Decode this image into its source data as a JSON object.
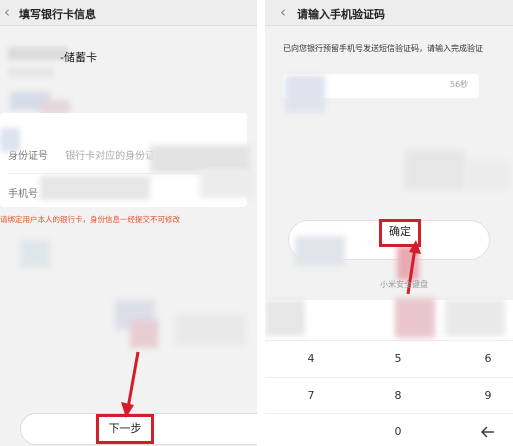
{
  "left_screen": {
    "back_icon": "chevron-left-icon",
    "title": "填写银行卡信息",
    "card_name": "-储蓄卡",
    "form": {
      "id_label": "身份证号",
      "id_placeholder": "银行卡对应的身份证号",
      "phone_label": "手机号"
    },
    "warning": "请绑定用户本人的银行卡，身份信息一经提交不可修改",
    "next_button": "下一步",
    "accent_color": "#d21d2b",
    "warning_color": "#e8522a"
  },
  "right_screen": {
    "back_icon": "chevron-left-icon",
    "title": "请输入手机验证码",
    "notice": "已向您银行预留手机号发送短信验证码，请输入完成验证",
    "timer": "56秒",
    "confirm_button": "确定",
    "keyboard_hint": "小米安全键盘",
    "keys": {
      "k4": "4",
      "k5": "5",
      "k6": "6",
      "k7": "7",
      "k8": "8",
      "k9": "9",
      "k0": "0",
      "backspace_icon": "backspace-icon"
    }
  }
}
